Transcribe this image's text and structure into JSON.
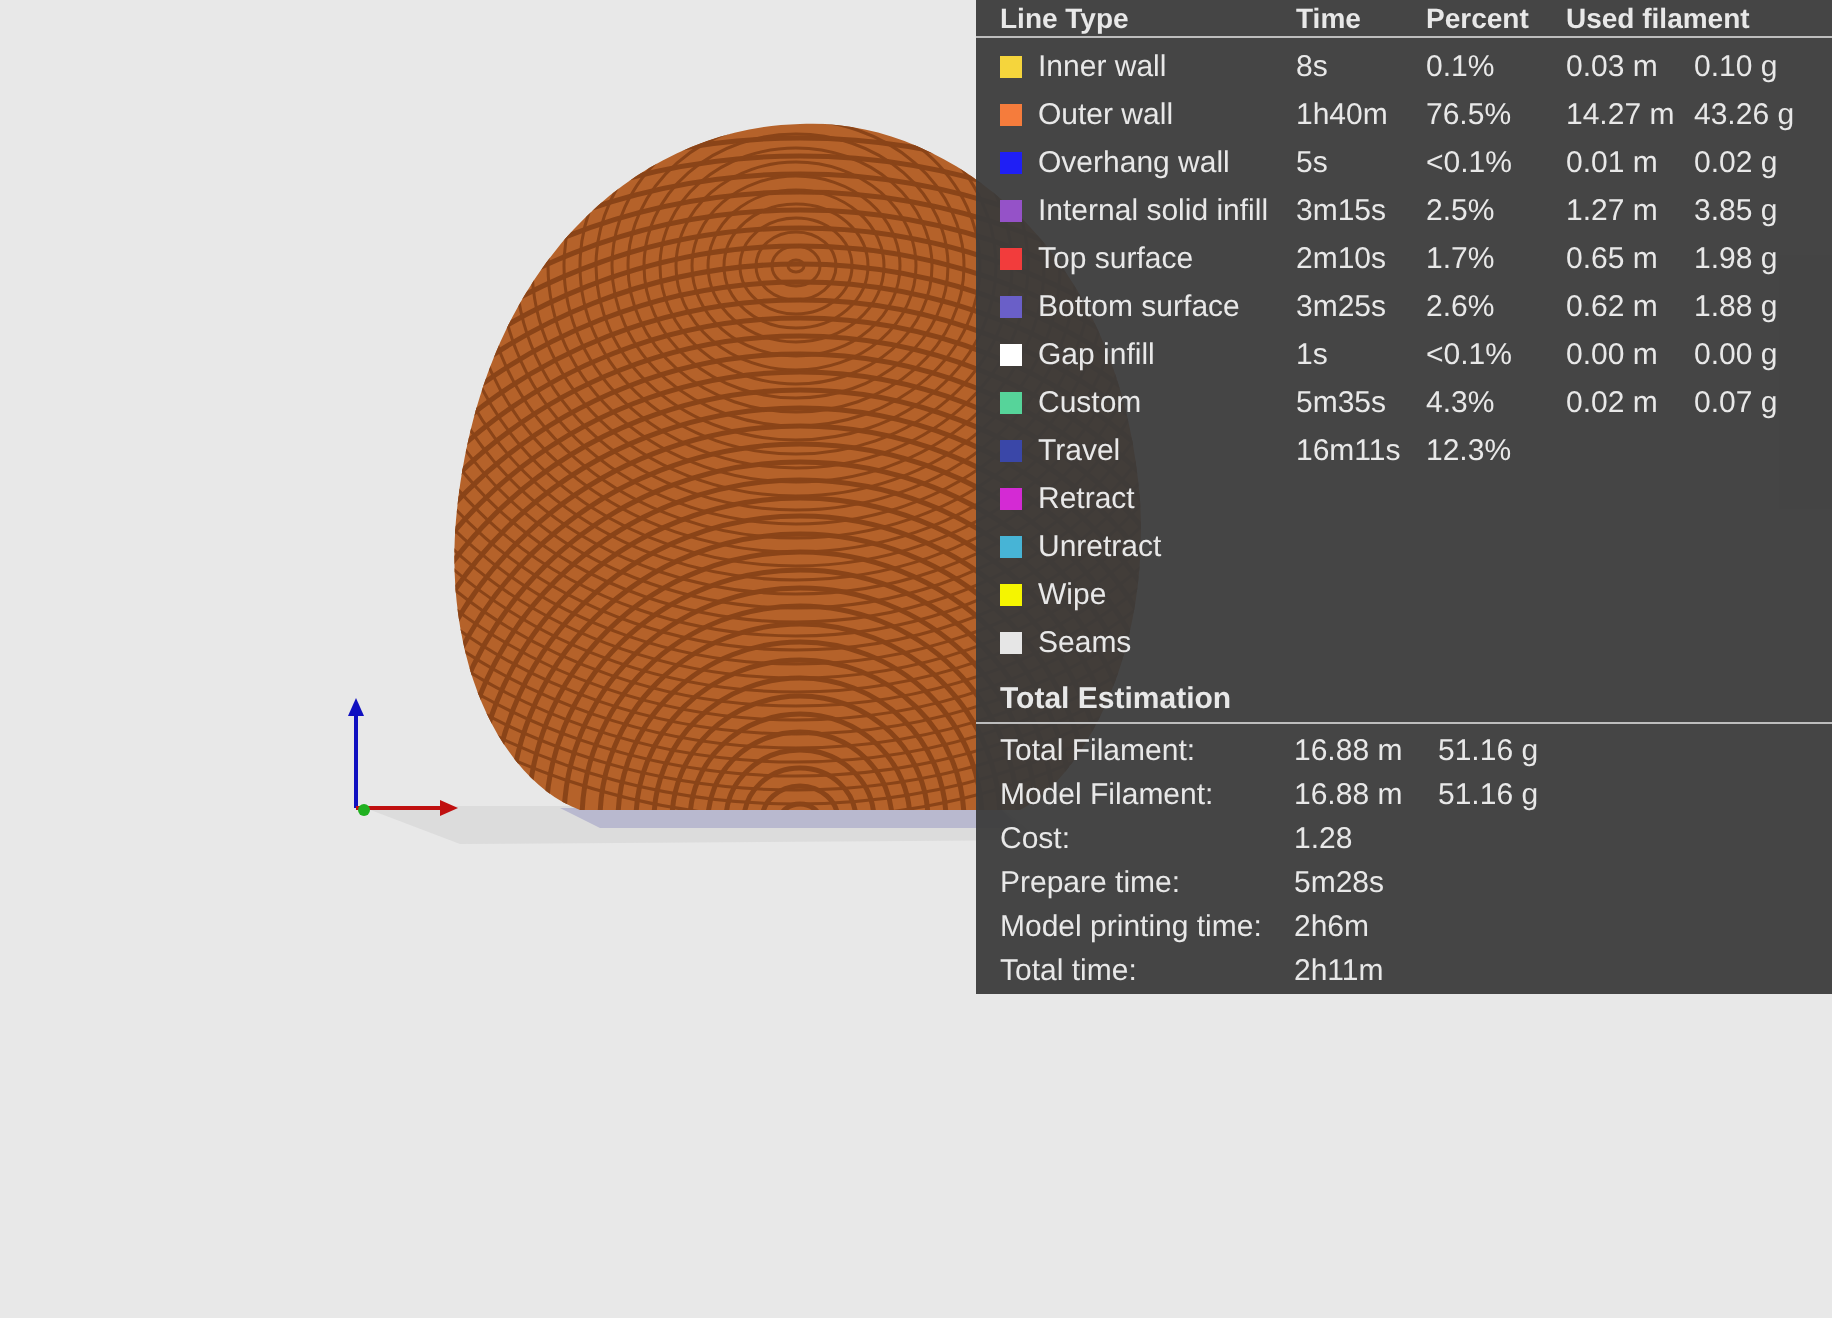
{
  "legend": {
    "columns": [
      "Line Type",
      "Time",
      "Percent",
      "Used filament"
    ],
    "rows": [
      {
        "color": "#f5d53c",
        "name": "Inner wall",
        "time": "8s",
        "percent": "0.1%",
        "length": "0.03 m",
        "weight": "0.10 g"
      },
      {
        "color": "#f57c3c",
        "name": "Outer wall",
        "time": "1h40m",
        "percent": "76.5%",
        "length": "14.27 m",
        "weight": "43.26 g"
      },
      {
        "color": "#1f1ff5",
        "name": "Overhang wall",
        "time": "5s",
        "percent": "<0.1%",
        "length": "0.01 m",
        "weight": "0.02 g"
      },
      {
        "color": "#9552c8",
        "name": "Internal solid infill",
        "time": "3m15s",
        "percent": "2.5%",
        "length": "1.27 m",
        "weight": "3.85 g"
      },
      {
        "color": "#f23c3c",
        "name": "Top surface",
        "time": "2m10s",
        "percent": "1.7%",
        "length": "0.65 m",
        "weight": "1.98 g"
      },
      {
        "color": "#6a5fc8",
        "name": "Bottom surface",
        "time": "3m25s",
        "percent": "2.6%",
        "length": "0.62 m",
        "weight": "1.88 g"
      },
      {
        "color": "#ffffff",
        "name": "Gap infill",
        "time": "1s",
        "percent": "<0.1%",
        "length": "0.00 m",
        "weight": "0.00 g"
      },
      {
        "color": "#56d49a",
        "name": "Custom",
        "time": "5m35s",
        "percent": "4.3%",
        "length": "0.02 m",
        "weight": "0.07 g"
      },
      {
        "color": "#3a47a8",
        "name": "Travel",
        "time": "16m11s",
        "percent": "12.3%"
      },
      {
        "color": "#d42ad4",
        "name": "Retract"
      },
      {
        "color": "#47b4d6",
        "name": "Unretract"
      },
      {
        "color": "#f5f500",
        "name": "Wipe"
      },
      {
        "color": "#e6e6e6",
        "name": "Seams"
      }
    ]
  },
  "total_estimation": {
    "title": "Total Estimation",
    "rows": [
      {
        "label": "Total Filament:",
        "value": "16.88 m",
        "value_2": "51.16 g"
      },
      {
        "label": "Model Filament:",
        "value": "16.88 m",
        "value_2": "51.16 g"
      },
      {
        "label": "Cost:",
        "value": "1.28"
      },
      {
        "label": "Prepare time:",
        "value": "5m28s"
      },
      {
        "label": "Model printing time:",
        "value": "2h6m"
      },
      {
        "label": "Total time:",
        "value": "2h11m"
      }
    ]
  }
}
